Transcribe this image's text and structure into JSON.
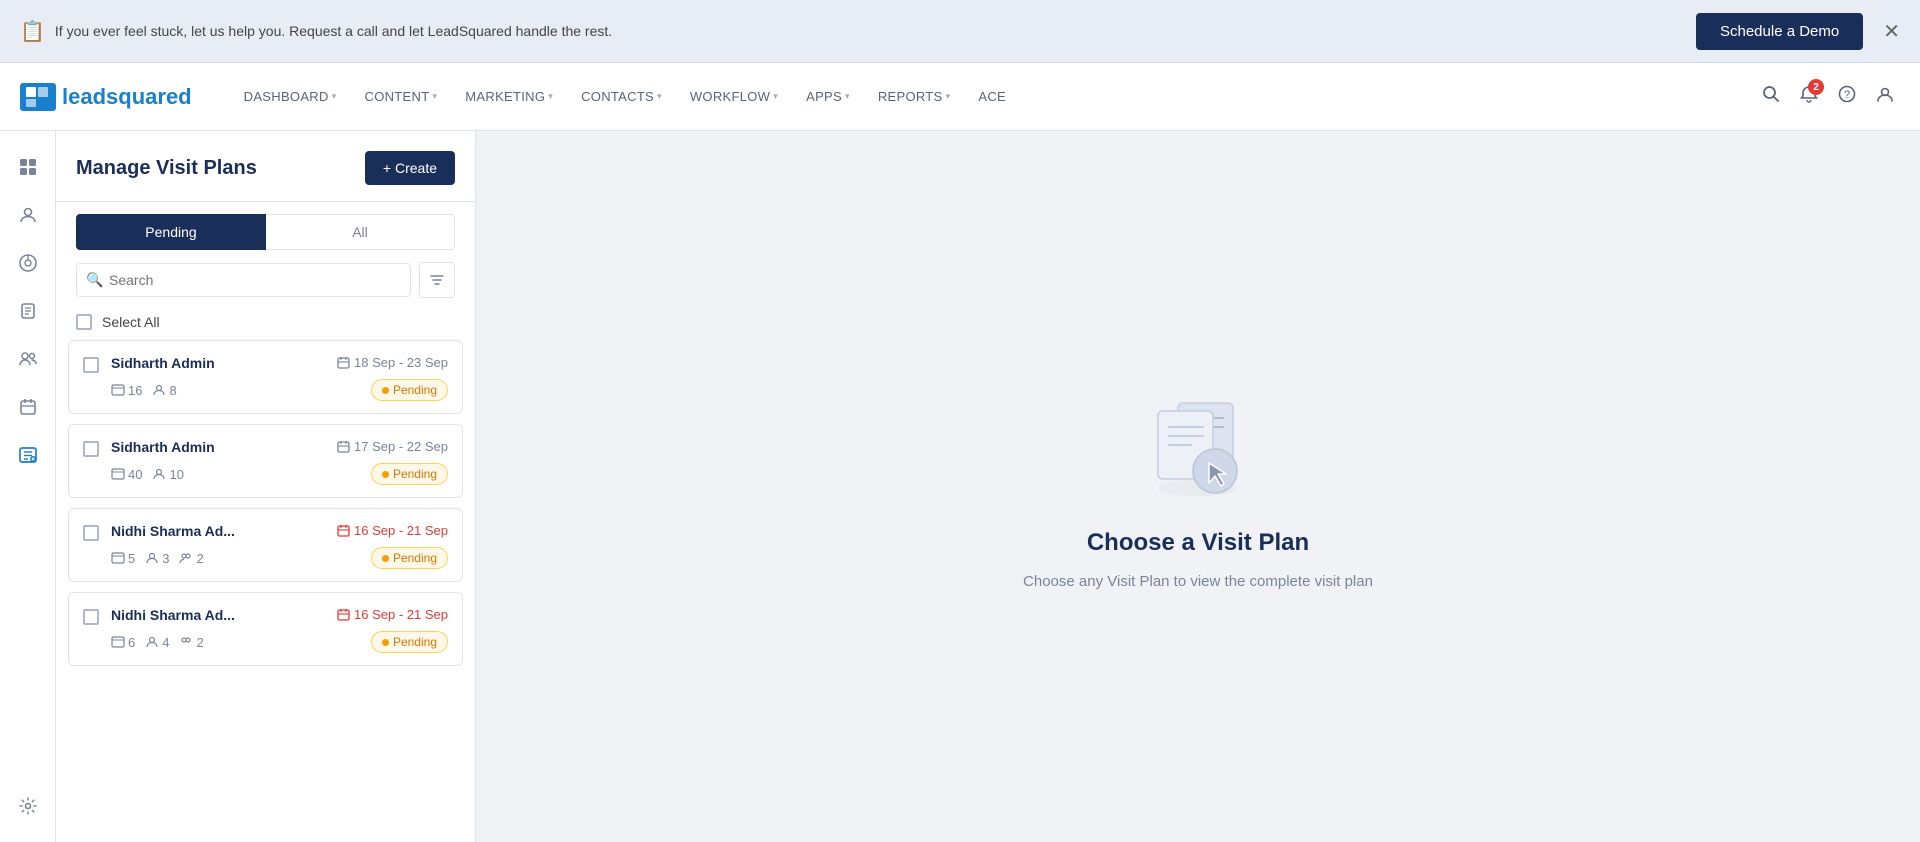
{
  "banner": {
    "text": "If you ever feel stuck, let us help you. Request a call and let LeadSquared handle the rest.",
    "icon": "📋",
    "cta": "Schedule a Demo"
  },
  "logo": {
    "text_lead": "lead",
    "text_squared": "squared"
  },
  "nav": {
    "items": [
      {
        "label": "DASHBOARD",
        "has_arrow": true
      },
      {
        "label": "CONTENT",
        "has_arrow": true
      },
      {
        "label": "MARKETING",
        "has_arrow": true
      },
      {
        "label": "CONTACTS",
        "has_arrow": true
      },
      {
        "label": "WORKFLOW",
        "has_arrow": true
      },
      {
        "label": "APPS",
        "has_arrow": true
      },
      {
        "label": "REPORTS",
        "has_arrow": true
      },
      {
        "label": "ACE",
        "has_arrow": false
      }
    ],
    "notification_count": "2"
  },
  "panel": {
    "title": "Manage Visit Plans",
    "create_label": "+ Create",
    "tabs": [
      {
        "label": "Pending",
        "active": true
      },
      {
        "label": "All",
        "active": false
      }
    ],
    "search_placeholder": "Search",
    "select_all_label": "Select All"
  },
  "cards": [
    {
      "name": "Sidharth Admin",
      "date_range": "18 Sep - 23 Sep",
      "date_overdue": false,
      "stat1_icon": "📅",
      "stat1_value": "16",
      "stat2_icon": "👤",
      "stat2_value": "8",
      "status": "Pending"
    },
    {
      "name": "Sidharth Admin",
      "date_range": "17 Sep - 22 Sep",
      "date_overdue": false,
      "stat1_icon": "📅",
      "stat1_value": "40",
      "stat2_icon": "👤",
      "stat2_value": "10",
      "status": "Pending"
    },
    {
      "name": "Nidhi Sharma Ad...",
      "date_range": "16 Sep - 21 Sep",
      "date_overdue": true,
      "stat1_icon": "📅",
      "stat1_value": "5",
      "stat2_icon": "👤",
      "stat2_value": "3",
      "stat3_value": "2",
      "status": "Pending"
    },
    {
      "name": "Nidhi Sharma Ad...",
      "date_range": "16 Sep - 21 Sep",
      "date_overdue": true,
      "stat1_icon": "📅",
      "stat1_value": "6",
      "stat2_icon": "👤",
      "stat2_value": "4",
      "stat3_value": "2",
      "status": "Pending"
    }
  ],
  "empty_state": {
    "title": "Choose a Visit Plan",
    "subtitle": "Choose any Visit Plan to view the complete visit plan"
  }
}
